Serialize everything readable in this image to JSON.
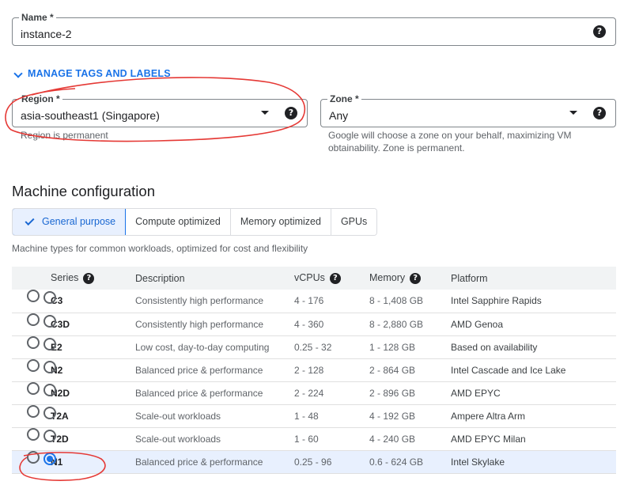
{
  "name_field": {
    "label": "Name *",
    "value": "instance-2",
    "help_icon": "help-icon"
  },
  "manage_tags": {
    "label": "MANAGE TAGS AND LABELS",
    "icon": "chevron-down-icon"
  },
  "region_field": {
    "label": "Region *",
    "value": "asia-southeast1 (Singapore)",
    "hint": "Region is permanent"
  },
  "zone_field": {
    "label": "Zone *",
    "value": "Any",
    "hint": "Google will choose a zone on your behalf, maximizing VM obtainability. Zone is permanent."
  },
  "machine_config": {
    "title": "Machine configuration",
    "tabs": [
      {
        "label": "General purpose",
        "active": true
      },
      {
        "label": "Compute optimized"
      },
      {
        "label": "Memory optimized"
      },
      {
        "label": "GPUs"
      }
    ],
    "tab_description": "Machine types for common workloads, optimized for cost and flexibility",
    "columns": [
      "Series",
      "Description",
      "vCPUs",
      "Memory",
      "Platform"
    ],
    "rows": [
      {
        "series": "C3",
        "description": "Consistently high performance",
        "vcpus": "4 - 176",
        "memory": "8 - 1,408 GB",
        "platform": "Intel Sapphire Rapids",
        "selected": false
      },
      {
        "series": "C3D",
        "description": "Consistently high performance",
        "vcpus": "4 - 360",
        "memory": "8 - 2,880 GB",
        "platform": "AMD Genoa",
        "selected": false
      },
      {
        "series": "E2",
        "description": "Low cost, day-to-day computing",
        "vcpus": "0.25 - 32",
        "memory": "1 - 128 GB",
        "platform": "Based on availability",
        "selected": false
      },
      {
        "series": "N2",
        "description": "Balanced price & performance",
        "vcpus": "2 - 128",
        "memory": "2 - 864 GB",
        "platform": "Intel Cascade and Ice Lake",
        "selected": false
      },
      {
        "series": "N2D",
        "description": "Balanced price & performance",
        "vcpus": "2 - 224",
        "memory": "2 - 896 GB",
        "platform": "AMD EPYC",
        "selected": false
      },
      {
        "series": "T2A",
        "description": "Scale-out workloads",
        "vcpus": "1 - 48",
        "memory": "4 - 192 GB",
        "platform": "Ampere Altra Arm",
        "selected": false
      },
      {
        "series": "T2D",
        "description": "Scale-out workloads",
        "vcpus": "1 - 60",
        "memory": "4 - 240 GB",
        "platform": "AMD EPYC Milan",
        "selected": false
      },
      {
        "series": "N1",
        "description": "Balanced price & performance",
        "vcpus": "0.25 - 96",
        "memory": "0.6 - 624 GB",
        "platform": "Intel Skylake",
        "selected": true
      }
    ]
  },
  "colors": {
    "accent": "#1a73e8",
    "annotation": "#e53935",
    "selected_row": "#e8f0fe"
  }
}
